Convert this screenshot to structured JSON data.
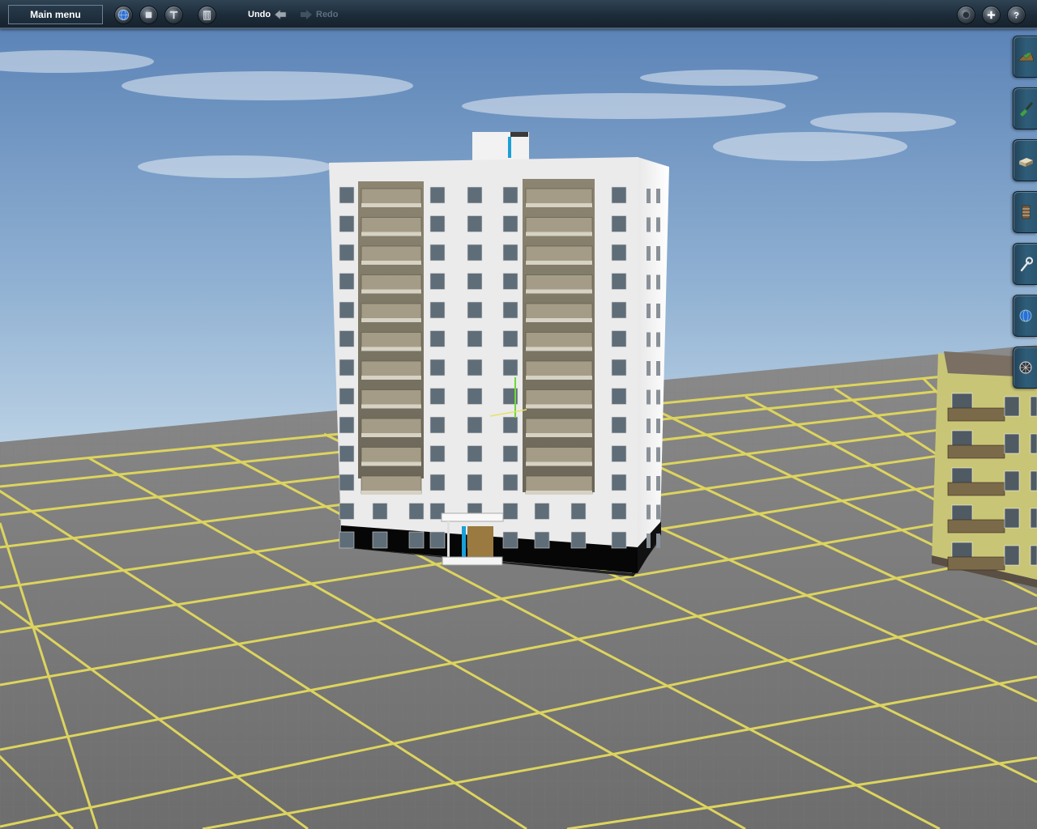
{
  "toolbar": {
    "main_menu_label": "Main menu",
    "undo_label": "Undo",
    "redo_label": "Redo",
    "left_buttons": [
      {
        "name": "globe-button",
        "icon": "globe-icon"
      },
      {
        "name": "stop-button",
        "icon": "stop-icon"
      },
      {
        "name": "tools-button",
        "icon": "tool-icon"
      },
      {
        "name": "trash-button",
        "icon": "trash-icon"
      }
    ],
    "right_buttons": [
      {
        "name": "camera-button",
        "icon": "camera-icon"
      },
      {
        "name": "add-button",
        "icon": "plus-icon"
      },
      {
        "name": "help-button",
        "icon": "help-icon"
      }
    ]
  },
  "side_tabs": [
    {
      "name": "tab-terrain",
      "icon": "terrain-icon"
    },
    {
      "name": "tab-paint",
      "icon": "paint-icon"
    },
    {
      "name": "tab-objects",
      "icon": "building-icon"
    },
    {
      "name": "tab-track",
      "icon": "track-icon"
    },
    {
      "name": "tab-tools",
      "icon": "wrench-icon"
    },
    {
      "name": "tab-topology",
      "icon": "globe-icon"
    },
    {
      "name": "tab-settings",
      "icon": "dial-icon"
    }
  ],
  "colors": {
    "toolbar_bg": "#1d2c3a",
    "grid_line": "#d9cf5a",
    "ground": "#6f6f6f",
    "sky_top": "#5f86b8",
    "sky_horizon": "#b9d0e3"
  }
}
